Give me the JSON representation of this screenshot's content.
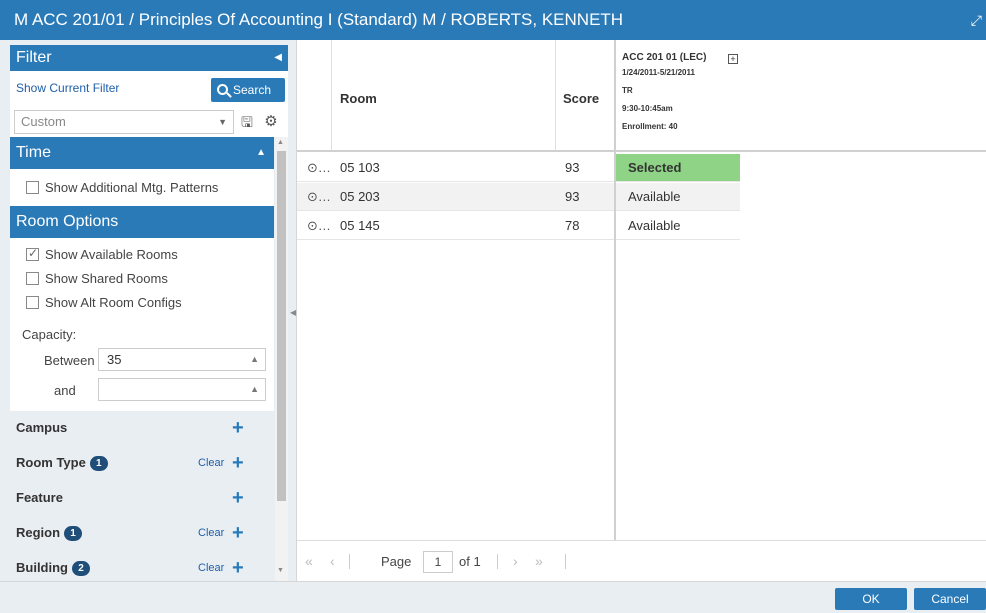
{
  "window": {
    "title": "M ACC 201/01 / Principles Of Accounting I (Standard) M / ROBERTS, KENNETH",
    "expand_icon": "expand-icon"
  },
  "filter": {
    "header": "Filter",
    "show_current": "Show Current Filter",
    "search_label": "Search",
    "preset_value": "Custom"
  },
  "time": {
    "header": "Time",
    "show_additional": "Show Additional Mtg. Patterns"
  },
  "room_options": {
    "header": "Room Options",
    "show_available": "Show Available Rooms",
    "show_shared": "Show Shared Rooms",
    "show_alt": "Show Alt Room Configs",
    "capacity_label": "Capacity:",
    "between_label": "Between",
    "between_value": "35",
    "and_label": "and",
    "and_value": ""
  },
  "facets": [
    {
      "label": "Campus",
      "badge": "",
      "clear": ""
    },
    {
      "label": "Room Type",
      "badge": "1",
      "clear": "Clear"
    },
    {
      "label": "Feature",
      "badge": "",
      "clear": ""
    },
    {
      "label": "Region",
      "badge": "1",
      "clear": "Clear"
    },
    {
      "label": "Building",
      "badge": "2",
      "clear": "Clear"
    }
  ],
  "grid": {
    "headers": {
      "room": "Room",
      "score": "Score"
    },
    "section": {
      "name": "ACC 201 01 (LEC)",
      "dates": "1/24/2011-5/21/2011",
      "days": "TR",
      "time": "9:30-10:45am",
      "enrollment": "Enrollment: 40"
    },
    "rows": [
      {
        "room": "05 103",
        "score": "93",
        "status": "Selected"
      },
      {
        "room": "05 203",
        "score": "93",
        "status": "Available"
      },
      {
        "room": "05 145",
        "score": "78",
        "status": "Available"
      }
    ]
  },
  "pager": {
    "page_label": "Page",
    "page_value": "1",
    "of_label": "of 1"
  },
  "footer": {
    "ok": "OK",
    "cancel": "Cancel"
  },
  "colors": {
    "accent": "#2a7ab8",
    "selected": "#8fd486",
    "panel_bg": "#e9eef3",
    "badge": "#1f4e79"
  }
}
